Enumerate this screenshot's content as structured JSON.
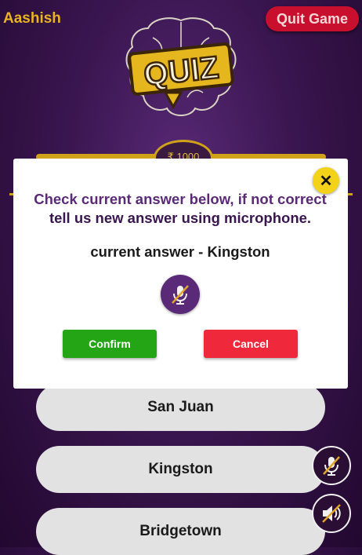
{
  "header": {
    "username": "Aashish",
    "quit_label": "Quit Game"
  },
  "logo": {
    "text": "QUIZ",
    "icon": "brain-icon"
  },
  "prize": {
    "amount": "₹ 1000"
  },
  "modal": {
    "message_line1": "Check current answer below, if not correct",
    "message_line2": "tell us new answer using microphone.",
    "current_answer": "current answer - Kingston",
    "confirm_label": "Confirm",
    "cancel_label": "Cancel",
    "mic_icon": "mic-off-icon",
    "close_icon": "close-icon"
  },
  "options": [
    {
      "label": "San Juan"
    },
    {
      "label": "Kingston"
    },
    {
      "label": "Bridgetown"
    }
  ],
  "side_controls": {
    "mic_icon": "mic-off-icon",
    "sound_icon": "sound-off-icon"
  },
  "colors": {
    "accent_gold": "#d0a21a",
    "brand_purple": "#5a2a78",
    "confirm_green": "#23a516",
    "cancel_red": "#f0283c",
    "quit_red": "#c8102e"
  }
}
